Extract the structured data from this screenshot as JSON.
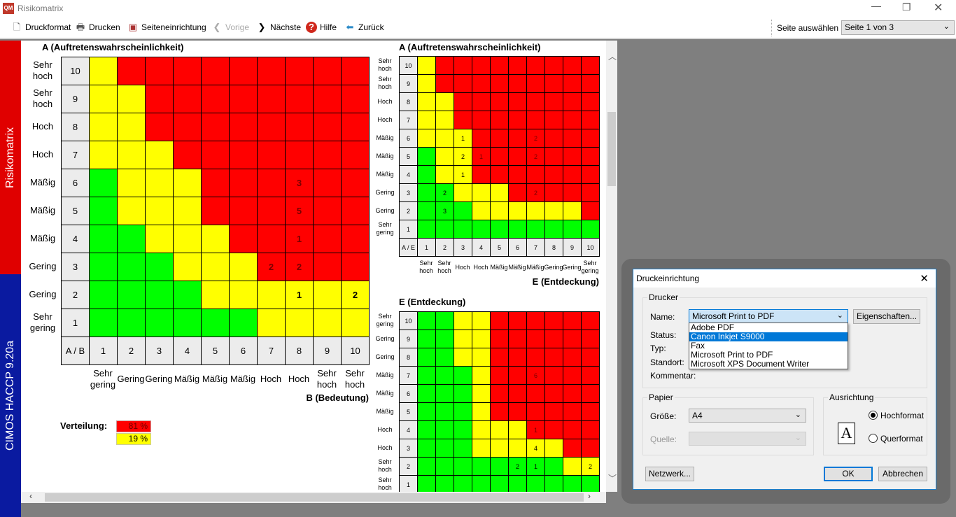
{
  "window": {
    "title": "Risikomatrix",
    "app_icon": "qm-logo-icon"
  },
  "toolbar": {
    "items": [
      {
        "label": "Druckformat",
        "icon": "document-icon"
      },
      {
        "label": "Drucken",
        "icon": "printer-icon"
      },
      {
        "label": "Seiteneinrichtung",
        "icon": "page-setup-icon"
      },
      {
        "label": "Vorige",
        "icon": "chevron-left-icon",
        "disabled": true
      },
      {
        "label": "Nächste",
        "icon": "chevron-right-icon"
      },
      {
        "label": "Hilfe",
        "icon": "help-icon"
      },
      {
        "label": "Zurück",
        "icon": "arrow-left-icon"
      }
    ],
    "page_select_label": "Seite auswählen",
    "page_select_value": "Seite 1 von 3"
  },
  "sidebar": {
    "top_label": "Risikomatrix",
    "bottom_label": "CIMOS HACCP 9.20a",
    "top_color": "#e00000",
    "bottom_color": "#0a1aa0"
  },
  "colors": {
    "G": "#00ff00",
    "Y": "#ffff00",
    "R": "#ff0000"
  },
  "matrices": [
    {
      "title": "A (Auftretenswahrscheinlichkeit)",
      "corner": "A / B",
      "xaxis_title": "B (Bedeutung)",
      "row_numbers": [
        "10",
        "9",
        "8",
        "7",
        "6",
        "5",
        "4",
        "3",
        "2",
        "1"
      ],
      "row_labels": [
        "Sehr hoch",
        "Sehr hoch",
        "Hoch",
        "Hoch",
        "Mäßig",
        "Mäßig",
        "Mäßig",
        "Gering",
        "Gering",
        "Sehr gering"
      ],
      "col_numbers": [
        "1",
        "2",
        "3",
        "4",
        "5",
        "6",
        "7",
        "8",
        "9",
        "10"
      ],
      "col_labels": [
        "Sehr gering",
        "Gering",
        "Gering",
        "Mäßig",
        "Mäßig",
        "Mäßig",
        "Hoch",
        "Hoch",
        "Sehr hoch",
        "Sehr hoch"
      ],
      "rows": [
        "YRRRRRRRRR",
        "YYRRRRRRRR",
        "YYRRRRRRRR",
        "YYYRRRRRRR",
        "GYYYRRRRRR",
        "GYYYRRRRRR",
        "GGYYYRRRRR",
        "GGGYYYRRRR",
        "GGGGYYYYYY",
        "GGGGGGYYYY"
      ],
      "counts": [
        {
          "row": "6",
          "col": "8",
          "value": "3"
        },
        {
          "row": "5",
          "col": "8",
          "value": "5"
        },
        {
          "row": "4",
          "col": "8",
          "value": "1"
        },
        {
          "row": "3",
          "col": "7",
          "value": "2"
        },
        {
          "row": "3",
          "col": "8",
          "value": "2"
        },
        {
          "row": "2",
          "col": "8",
          "value": "1"
        },
        {
          "row": "2",
          "col": "10",
          "value": "2"
        }
      ]
    },
    {
      "title": "A (Auftretenswahrscheinlichkeit)",
      "corner": "A / E",
      "xaxis_title": "E (Entdeckung)",
      "row_numbers": [
        "10",
        "9",
        "8",
        "7",
        "6",
        "5",
        "4",
        "3",
        "2",
        "1"
      ],
      "row_labels": [
        "Sehr hoch",
        "Sehr hoch",
        "Hoch",
        "Hoch",
        "Mäßig",
        "Mäßig",
        "Mäßig",
        "Gering",
        "Gering",
        "Sehr gering"
      ],
      "col_numbers": [
        "1",
        "2",
        "3",
        "4",
        "5",
        "6",
        "7",
        "8",
        "9",
        "10"
      ],
      "col_labels": [
        "Sehr hoch",
        "Sehr hoch",
        "Hoch",
        "Hoch",
        "Mäßig",
        "Mäßig",
        "Mäßig",
        "Gering",
        "Gering",
        "Sehr gering"
      ],
      "rows": [
        "YRRRRRRRRR",
        "YRRRRRRRRR",
        "YYRRRRRRRR",
        "YYRRRRRRRR",
        "YYYRRRRRRR",
        "GYYRRRRRRR",
        "GYYRRRRRRR",
        "GGYYYRRRRR",
        "GGGYYYYYYR",
        "GGGGGGGGGG"
      ],
      "counts": [
        {
          "row": "6",
          "col": "3",
          "value": "1"
        },
        {
          "row": "6",
          "col": "7",
          "value": "2"
        },
        {
          "row": "5",
          "col": "3",
          "value": "2"
        },
        {
          "row": "5",
          "col": "4",
          "value": "1"
        },
        {
          "row": "5",
          "col": "7",
          "value": "2"
        },
        {
          "row": "4",
          "col": "3",
          "value": "1"
        },
        {
          "row": "3",
          "col": "2",
          "value": "2"
        },
        {
          "row": "3",
          "col": "7",
          "value": "2"
        },
        {
          "row": "2",
          "col": "2",
          "value": "3"
        }
      ]
    },
    {
      "title": "E (Entdeckung)",
      "row_numbers": [
        "10",
        "9",
        "8",
        "7",
        "6",
        "5",
        "4",
        "3",
        "2",
        "1"
      ],
      "row_labels": [
        "Sehr gering",
        "Gering",
        "Gering",
        "Mäßig",
        "Mäßig",
        "Mäßig",
        "Hoch",
        "Hoch",
        "Sehr hoch",
        "Sehr hoch"
      ],
      "rows": [
        "GGYYRRRRRR",
        "GGYYRRRRRR",
        "GGYYRRRRRR",
        "GGGYRRRRRR",
        "GGGYRRRRRR",
        "GGGYRRRRRR",
        "GGGYYYRRRR",
        "GGGYYYYYRR",
        "GGGGGGGGYY",
        "GGGGGGGGGG"
      ],
      "counts": [
        {
          "row": "7",
          "col": "7",
          "value": "6"
        },
        {
          "row": "4",
          "col": "7",
          "value": "1"
        },
        {
          "row": "3",
          "col": "7",
          "value": "4"
        },
        {
          "row": "2",
          "col": "6",
          "value": "2"
        },
        {
          "row": "2",
          "col": "7",
          "value": "1"
        },
        {
          "row": "2",
          "col": "10",
          "value": "2"
        }
      ]
    }
  ],
  "distribution": {
    "label": "Verteilung:",
    "values": [
      {
        "text": "81 %",
        "color": "#ff0000"
      },
      {
        "text": "19 %",
        "color": "#ffff00"
      }
    ]
  },
  "dialog": {
    "title": "Druckeinrichtung",
    "printer_group": "Drucker",
    "name_label": "Name:",
    "name_value": "Microsoft Print to PDF",
    "properties_button": "Eigenschaften...",
    "printer_options": [
      "Adobe PDF",
      "Canon Inkjet S9000",
      "Fax",
      "Microsoft Print to PDF",
      "Microsoft XPS Document Writer"
    ],
    "highlighted_option": "Canon Inkjet S9000",
    "status_label": "Status:",
    "type_label": "Typ:",
    "location_label": "Standort:",
    "comment_label": "Kommentar:",
    "paper_group": "Papier",
    "size_label": "Größe:",
    "size_value": "A4",
    "source_label": "Quelle:",
    "orientation_group": "Ausrichtung",
    "portrait_label": "Hochformat",
    "landscape_label": "Querformat",
    "orientation": "Hochformat",
    "orientation_icon_letter": "A",
    "network_button": "Netzwerk...",
    "ok_button": "OK",
    "cancel_button": "Abbrechen"
  }
}
